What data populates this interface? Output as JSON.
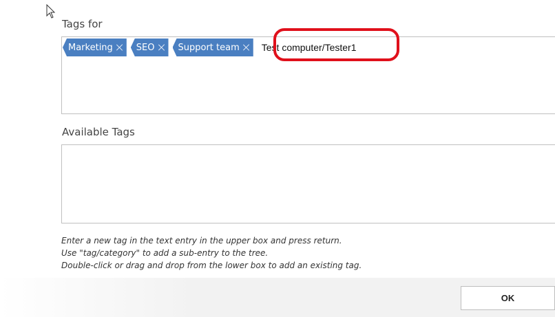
{
  "dialog": {
    "tags_for_label": "Tags for",
    "current_tags": [
      {
        "label": "Marketing"
      },
      {
        "label": "SEO"
      },
      {
        "label": "Support team"
      }
    ],
    "tag_input_value": "Test computer/Tester1",
    "available_tags_label": "Available Tags",
    "available_tags": [],
    "help_lines": [
      "Enter a new tag in the text entry in the upper box and press return.",
      "Use \"tag/category\" to add a sub-entry to the tree.",
      "Double-click or drag and drop from the lower box to add an existing tag."
    ],
    "ok_label": "OK"
  },
  "colors": {
    "tag_background": "#4a7fc1",
    "highlight": "#e0101b"
  },
  "icons": {
    "cursor": "mouse-pointer-icon",
    "tag_remove": "close-icon"
  }
}
